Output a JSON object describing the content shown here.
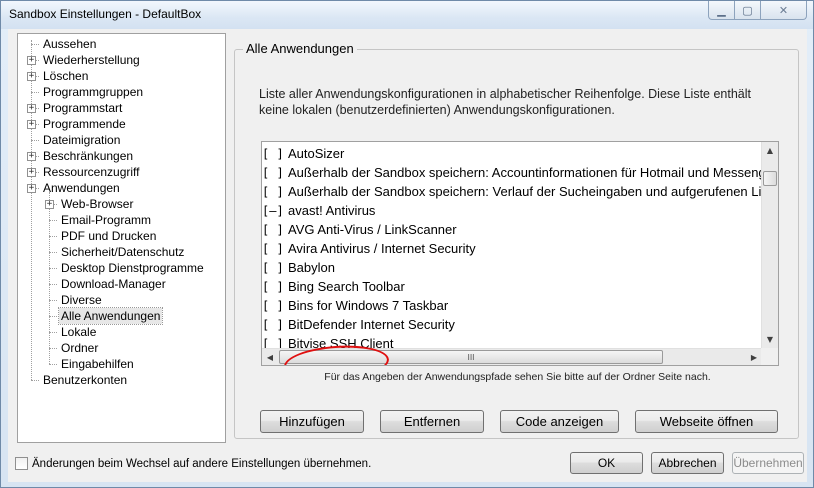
{
  "window": {
    "title": "Sandbox Einstellungen - DefaultBox"
  },
  "tree": {
    "items": [
      {
        "label": "Aussehen",
        "level": 0,
        "expander": false
      },
      {
        "label": "Wiederherstellung",
        "level": 0,
        "expander": true
      },
      {
        "label": "Löschen",
        "level": 0,
        "expander": true
      },
      {
        "label": "Programmgruppen",
        "level": 0,
        "expander": false
      },
      {
        "label": "Programmstart",
        "level": 0,
        "expander": true
      },
      {
        "label": "Programmende",
        "level": 0,
        "expander": true
      },
      {
        "label": "Dateimigration",
        "level": 0,
        "expander": false
      },
      {
        "label": "Beschränkungen",
        "level": 0,
        "expander": true
      },
      {
        "label": "Ressourcenzugriff",
        "level": 0,
        "expander": true
      },
      {
        "label": "Anwendungen",
        "level": 0,
        "expander": true,
        "expanded": true
      },
      {
        "label": "Web-Browser",
        "level": 1,
        "expander": true
      },
      {
        "label": "Email-Programm",
        "level": 1,
        "expander": false
      },
      {
        "label": "PDF und Drucken",
        "level": 1,
        "expander": false
      },
      {
        "label": "Sicherheit/Datenschutz",
        "level": 1,
        "expander": false
      },
      {
        "label": "Desktop Dienstprogramme",
        "level": 1,
        "expander": false
      },
      {
        "label": "Download-Manager",
        "level": 1,
        "expander": false
      },
      {
        "label": "Diverse",
        "level": 1,
        "expander": false
      },
      {
        "label": "Alle Anwendungen",
        "level": 1,
        "expander": false,
        "selected": true
      },
      {
        "label": "Lokale",
        "level": 1,
        "expander": false
      },
      {
        "label": "Ordner",
        "level": 1,
        "expander": false
      },
      {
        "label": "Eingabehilfen",
        "level": 1,
        "expander": false
      },
      {
        "label": "Benutzerkonten",
        "level": 0,
        "expander": false
      }
    ]
  },
  "group": {
    "title": "Alle Anwendungen",
    "description": "Liste aller Anwendungskonfigurationen in alphabetischer Reihenfolge. Diese Liste enthält keine lokalen (benutzerdefinierten) Anwendungskonfigurationen.",
    "hint": "Für das Angeben der Anwendungspfade sehen Sie bitte auf der Ordner Seite nach."
  },
  "apps": [
    {
      "check": "[  ]",
      "name": "AutoSizer"
    },
    {
      "check": "[  ]",
      "name": "Außerhalb der Sandbox speichern: Accountinformationen für Hotmail und Messenger"
    },
    {
      "check": "[  ]",
      "name": "Außerhalb der Sandbox speichern: Verlauf der Sucheingaben und aufgerufenen Links"
    },
    {
      "check": "[—]",
      "name": "avast! Antivirus"
    },
    {
      "check": "[  ]",
      "name": "AVG Anti-Virus / LinkScanner"
    },
    {
      "check": "[  ]",
      "name": "Avira Antivirus / Internet Security"
    },
    {
      "check": "[  ]",
      "name": "Babylon"
    },
    {
      "check": "[  ]",
      "name": "Bing Search Toolbar"
    },
    {
      "check": "[  ]",
      "name": "Bins for Windows 7 Taskbar"
    },
    {
      "check": "[  ]",
      "name": "BitDefender Internet Security"
    },
    {
      "check": "[  ]",
      "name": "Bitvise SSH Client"
    }
  ],
  "buttons": {
    "add": "Hinzufügen",
    "remove": "Entfernen",
    "show_code": "Code anzeigen",
    "open_website": "Webseite öffnen",
    "ok": "OK",
    "cancel": "Abbrechen",
    "apply": "Übernehmen"
  },
  "footer": {
    "apply_on_switch": "Änderungen beim Wechsel auf andere Einstellungen übernehmen.",
    "apply_on_switch_checked": false
  },
  "scroll": {
    "h_thumb_label": "III"
  },
  "icons": {
    "expander": "plus-glyph",
    "scroll_up": "▲",
    "scroll_down": "▼",
    "scroll_left": "◀",
    "scroll_right": "▶"
  },
  "colors": {
    "annotation_circle": "#e01010"
  }
}
